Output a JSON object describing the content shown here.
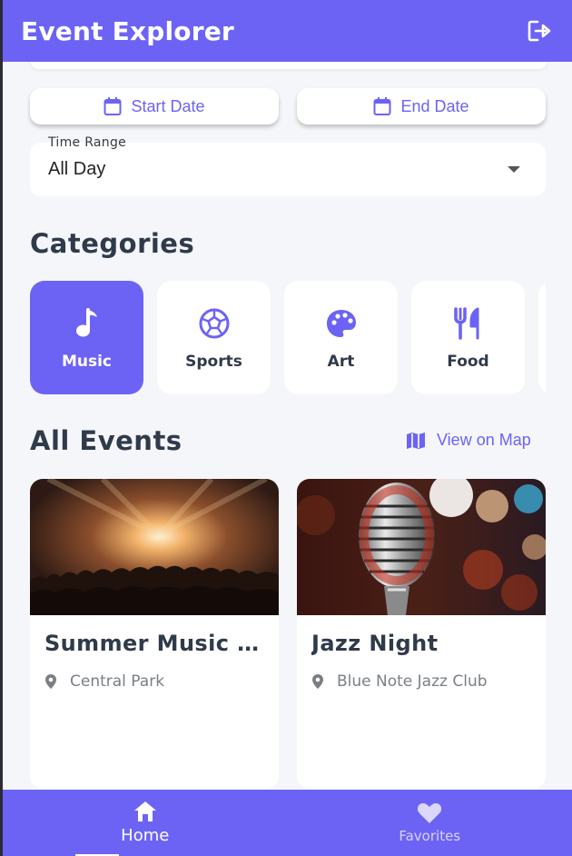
{
  "app": {
    "title": "Event Explorer"
  },
  "colors": {
    "primary": "#6c63f5",
    "background": "#f5f6fa",
    "text_dark": "#2f3a4a",
    "text_muted": "#7a7f86"
  },
  "filters": {
    "start_date_label": "Start Date",
    "end_date_label": "End Date",
    "time_range": {
      "label": "Time Range",
      "value": "All Day"
    }
  },
  "categories": {
    "title": "Categories",
    "items": [
      {
        "label": "Music",
        "icon": "music-note-icon",
        "selected": true
      },
      {
        "label": "Sports",
        "icon": "soccer-ball-icon",
        "selected": false
      },
      {
        "label": "Art",
        "icon": "palette-icon",
        "selected": false
      },
      {
        "label": "Food",
        "icon": "fork-knife-icon",
        "selected": false
      }
    ]
  },
  "events": {
    "title": "All Events",
    "view_map_label": "View on Map",
    "items": [
      {
        "title": "Summer Music F…",
        "location": "Central Park",
        "image": "concert-crowd-photo"
      },
      {
        "title": "Jazz Night",
        "location": "Blue Note Jazz Club",
        "image": "vintage-microphone-photo"
      }
    ]
  },
  "bottom_nav": {
    "items": [
      {
        "label": "Home",
        "icon": "home-icon",
        "active": true
      },
      {
        "label": "Favorites",
        "icon": "heart-icon",
        "active": false
      }
    ]
  }
}
